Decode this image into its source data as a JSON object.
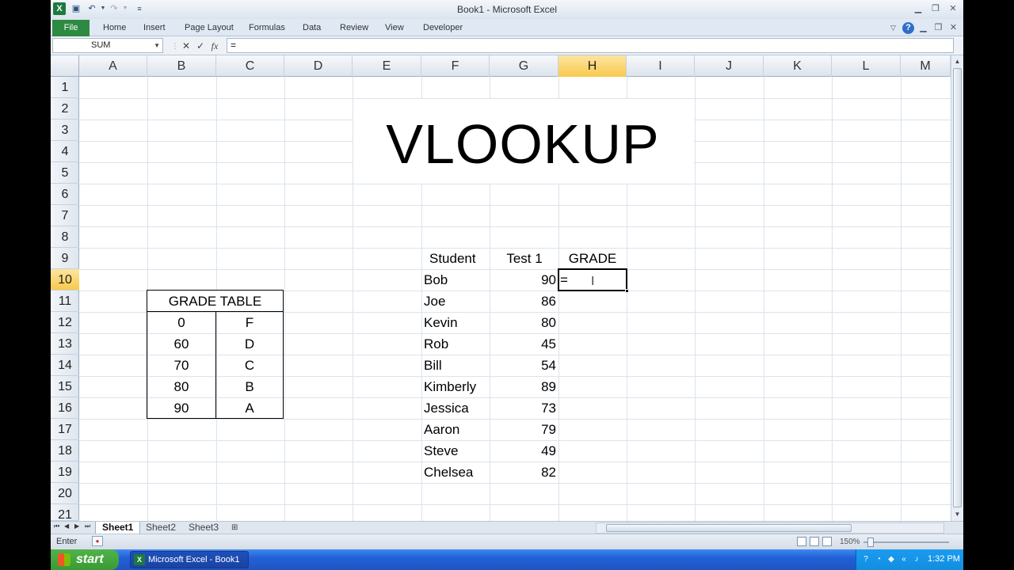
{
  "window": {
    "title": "Book1  -  Microsoft Excel",
    "quick_access": [
      "save-icon",
      "undo-icon",
      "redo-icon",
      "customize-icon"
    ],
    "controls": [
      "minimize-icon",
      "restore-icon",
      "close-icon"
    ]
  },
  "ribbon": {
    "file_label": "File",
    "tabs": [
      "Home",
      "Insert",
      "Page Layout",
      "Formulas",
      "Data",
      "Review",
      "View",
      "Developer"
    ]
  },
  "formula_bar": {
    "name_box": "SUM",
    "cancel": "✕",
    "enter": "✓",
    "fx": "fx",
    "content": "="
  },
  "columns": [
    "A",
    "B",
    "C",
    "D",
    "E",
    "F",
    "G",
    "H",
    "I",
    "J",
    "K",
    "L",
    "M"
  ],
  "rows": [
    "1",
    "2",
    "3",
    "4",
    "5",
    "6",
    "7",
    "8",
    "9",
    "10",
    "11",
    "12",
    "13",
    "14",
    "15",
    "16",
    "17",
    "18",
    "19",
    "20",
    "21"
  ],
  "active_cell": {
    "column": "H",
    "row": "10",
    "content": "="
  },
  "sheet_title": "VLOOKUP",
  "students_table": {
    "headers": {
      "student": "Student",
      "test": "Test 1",
      "grade": "GRADE"
    },
    "rows": [
      {
        "name": "Bob",
        "score": "90"
      },
      {
        "name": "Joe",
        "score": "86"
      },
      {
        "name": "Kevin",
        "score": "80"
      },
      {
        "name": "Rob",
        "score": "45"
      },
      {
        "name": "Bill",
        "score": "54"
      },
      {
        "name": "Kimberly",
        "score": "89"
      },
      {
        "name": "Jessica",
        "score": "73"
      },
      {
        "name": "Aaron",
        "score": "79"
      },
      {
        "name": "Steve",
        "score": "49"
      },
      {
        "name": "Chelsea",
        "score": "82"
      }
    ]
  },
  "grade_table": {
    "title": "GRADE TABLE",
    "rows": [
      {
        "min": "0",
        "grade": "F"
      },
      {
        "min": "60",
        "grade": "D"
      },
      {
        "min": "70",
        "grade": "C"
      },
      {
        "min": "80",
        "grade": "B"
      },
      {
        "min": "90",
        "grade": "A"
      }
    ]
  },
  "sheets": [
    "Sheet1",
    "Sheet2",
    "Sheet3"
  ],
  "active_sheet": "Sheet1",
  "status": {
    "mode": "Enter",
    "zoom": "150%"
  },
  "taskbar": {
    "start_label": "start",
    "window_item": "Microsoft Excel - Book1",
    "clock": "1:32 PM"
  }
}
